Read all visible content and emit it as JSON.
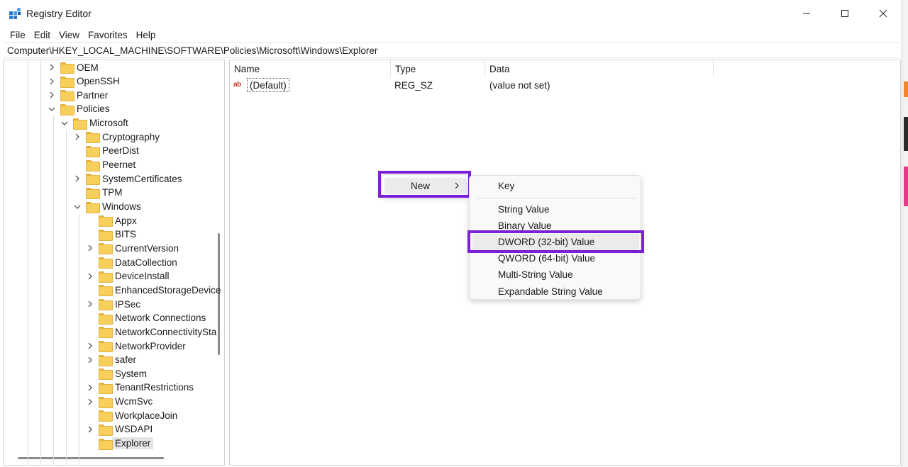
{
  "window": {
    "title": "Registry Editor",
    "controls": {
      "minimize": "—",
      "maximize": "☐",
      "close": "✕"
    }
  },
  "menubar": [
    "File",
    "Edit",
    "View",
    "Favorites",
    "Help"
  ],
  "address": "Computer\\HKEY_LOCAL_MACHINE\\SOFTWARE\\Policies\\Microsoft\\Windows\\Explorer",
  "tree": [
    {
      "label": "OEM",
      "level": 0,
      "chevron": "right"
    },
    {
      "label": "OpenSSH",
      "level": 0,
      "chevron": "right"
    },
    {
      "label": "Partner",
      "level": 0,
      "chevron": "right"
    },
    {
      "label": "Policies",
      "level": 0,
      "chevron": "down"
    },
    {
      "label": "Microsoft",
      "level": 1,
      "chevron": "down"
    },
    {
      "label": "Cryptography",
      "level": 2,
      "chevron": "right"
    },
    {
      "label": "PeerDist",
      "level": 2,
      "chevron": "none"
    },
    {
      "label": "Peernet",
      "level": 2,
      "chevron": "none"
    },
    {
      "label": "SystemCertificates",
      "level": 2,
      "chevron": "right"
    },
    {
      "label": "TPM",
      "level": 2,
      "chevron": "none"
    },
    {
      "label": "Windows",
      "level": 2,
      "chevron": "down"
    },
    {
      "label": "Appx",
      "level": 3,
      "chevron": "none"
    },
    {
      "label": "BITS",
      "level": 3,
      "chevron": "none"
    },
    {
      "label": "CurrentVersion",
      "level": 3,
      "chevron": "right"
    },
    {
      "label": "DataCollection",
      "level": 3,
      "chevron": "none"
    },
    {
      "label": "DeviceInstall",
      "level": 3,
      "chevron": "right"
    },
    {
      "label": "EnhancedStorageDevice",
      "level": 3,
      "chevron": "none"
    },
    {
      "label": "IPSec",
      "level": 3,
      "chevron": "right"
    },
    {
      "label": "Network Connections",
      "level": 3,
      "chevron": "none"
    },
    {
      "label": "NetworkConnectivitySta",
      "level": 3,
      "chevron": "none"
    },
    {
      "label": "NetworkProvider",
      "level": 3,
      "chevron": "right"
    },
    {
      "label": "safer",
      "level": 3,
      "chevron": "right"
    },
    {
      "label": "System",
      "level": 3,
      "chevron": "none"
    },
    {
      "label": "TenantRestrictions",
      "level": 3,
      "chevron": "right"
    },
    {
      "label": "WcmSvc",
      "level": 3,
      "chevron": "right"
    },
    {
      "label": "WorkplaceJoin",
      "level": 3,
      "chevron": "none"
    },
    {
      "label": "WSDAPI",
      "level": 3,
      "chevron": "right"
    },
    {
      "label": "Explorer",
      "level": 3,
      "chevron": "none",
      "selected": true
    }
  ],
  "values": {
    "columns": [
      "Name",
      "Type",
      "Data"
    ],
    "rows": [
      {
        "name": "(Default)",
        "type": "REG_SZ",
        "data": "(value not set)",
        "icon": "string-value-icon"
      }
    ]
  },
  "context_menu": {
    "new_label": "New",
    "submenu": [
      "Key",
      "String Value",
      "Binary Value",
      "DWORD (32-bit) Value",
      "QWORD (64-bit) Value",
      "Multi-String Value",
      "Expandable String Value"
    ],
    "highlighted_item": "DWORD (32-bit) Value"
  },
  "colors": {
    "highlight_border": "#7c1fd6",
    "folder": "#f7cf5b",
    "selection": "#e5e5e5"
  }
}
